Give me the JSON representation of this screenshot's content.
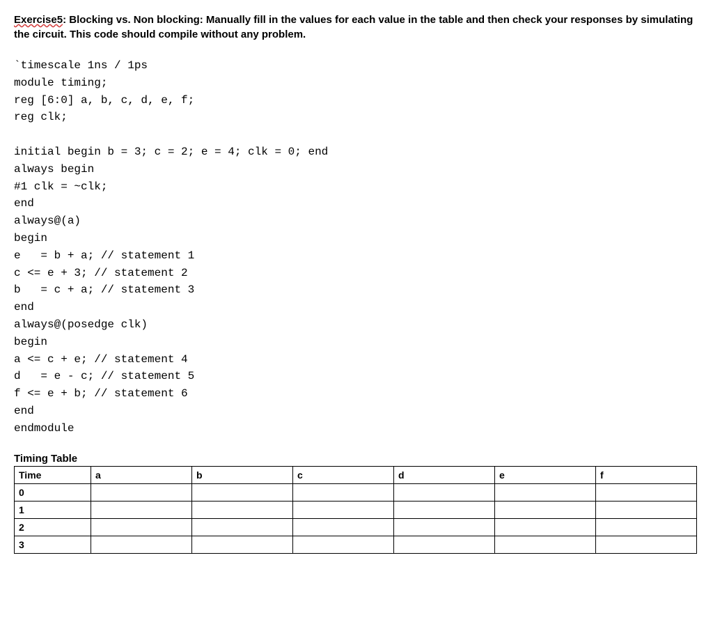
{
  "heading": {
    "exercise_label": "Exercise5",
    "colon": ": ",
    "title_rest": "Blocking vs. Non blocking: Manually fill in the values for each value in the table and then check your responses by simulating the circuit.  This code should compile without any problem."
  },
  "code_lines": [
    "`timescale 1ns / 1ps",
    "module timing;",
    "reg [6:0] a, b, c, d, e, f;",
    "reg clk;",
    "",
    "initial begin b = 3; c = 2; e = 4; clk = 0; end",
    "always begin",
    "#1 clk = ~clk;",
    "end",
    "always@(a)",
    "begin",
    "e   = b + a; // statement 1",
    "c <= e + 3; // statement 2",
    "b   = c + a; // statement 3",
    "end",
    "always@(posedge clk)",
    "begin",
    "a <= c + e; // statement 4",
    "d   = e - c; // statement 5",
    "f <= e + b; // statement 6",
    "end",
    "endmodule"
  ],
  "timing_table_title": "Timing Table",
  "table": {
    "headers": [
      "Time",
      "a",
      "b",
      "c",
      "d",
      "e",
      "f"
    ],
    "rows": [
      {
        "time": "0",
        "a": "",
        "b": "",
        "c": "",
        "d": "",
        "e": "",
        "f": ""
      },
      {
        "time": "1",
        "a": "",
        "b": "",
        "c": "",
        "d": "",
        "e": "",
        "f": ""
      },
      {
        "time": "2",
        "a": "",
        "b": "",
        "c": "",
        "d": "",
        "e": "",
        "f": ""
      },
      {
        "time": "3",
        "a": "",
        "b": "",
        "c": "",
        "d": "",
        "e": "",
        "f": ""
      }
    ]
  }
}
